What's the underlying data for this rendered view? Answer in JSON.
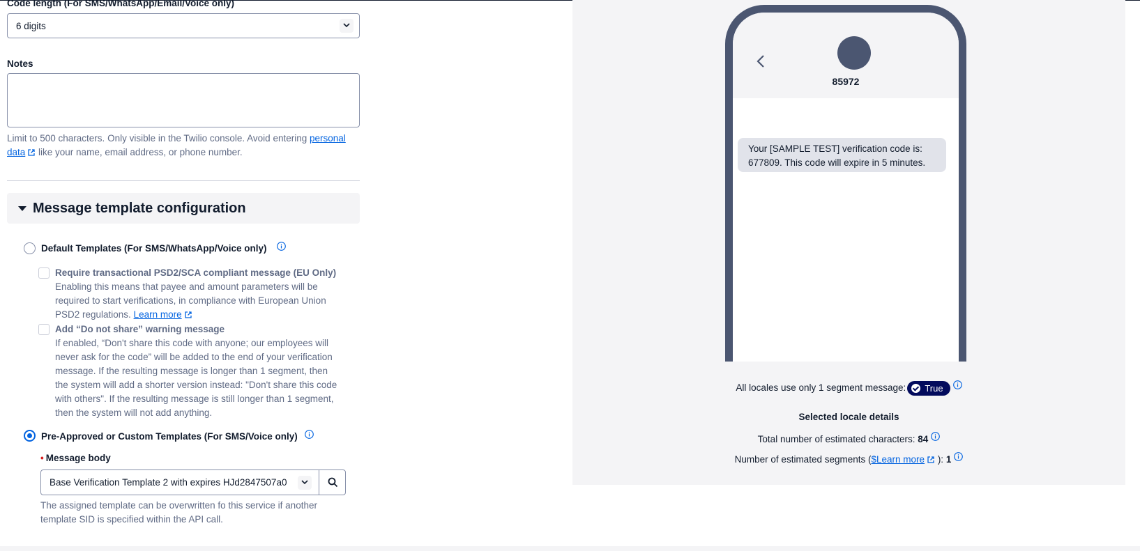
{
  "code_length": {
    "label": "Code length (For SMS/WhatsApp/Email/Voice only)",
    "value": "6 digits"
  },
  "notes": {
    "label": "Notes",
    "value": "",
    "help_before": "Limit to 500 characters. Only visible in the Twilio console. Avoid entering ",
    "help_link": "personal data",
    "help_after": " like your name, email address, or phone number."
  },
  "template_section": {
    "title": "Message template configuration",
    "default_option": {
      "label": "Default Templates (For SMS/WhatsApp/Voice only)",
      "selected": false
    },
    "psd2": {
      "label": "Require transactional PSD2/SCA compliant message (EU Only)",
      "description": "Enabling this means that payee and amount parameters will be required to start verifications, in compliance with European Union PSD2 regulations.",
      "link": "Learn more",
      "checked": false
    },
    "do_not_share": {
      "label": "Add “Do not share” warning message",
      "description": "If enabled, “Don't share this code with anyone; our employees will never ask for the code” will be added to the end of your verification message. If the resulting message is longer than 1 segment, then the system will add a shorter version instead: \"Don't share this code with others\". If the resulting message is still longer than 1 segment, then the system will not add anything.",
      "checked": false
    },
    "custom_option": {
      "label": "Pre-Approved or Custom Templates (For SMS/Voice only)",
      "selected": true
    },
    "message_body": {
      "required_mark": "•",
      "label": "Message body",
      "value": "Base Verification Template 2 with expires HJd2847507a0",
      "help": "The assigned template can be overwritten fo this service if another template SID is specified within the API call."
    }
  },
  "preview": {
    "sender": "85972",
    "message": "Your [SAMPLE TEST] verification code is: 677809. This code will expire in 5 minutes.",
    "segment_label": "All locales use only 1 segment message:",
    "segment_badge": "True",
    "locale_heading": "Selected locale details",
    "chars_label": "Total number of estimated characters:",
    "chars_value": "84",
    "segments_label_before": "Number of estimated segments (",
    "segments_link": "$Learn more",
    "segments_label_after": "):",
    "segments_value": "1"
  },
  "colors": {
    "accent": "#0263e0",
    "badge": "#030b5d",
    "phone_frame": "#4b5671",
    "panel_bg": "#f4f4f6"
  }
}
